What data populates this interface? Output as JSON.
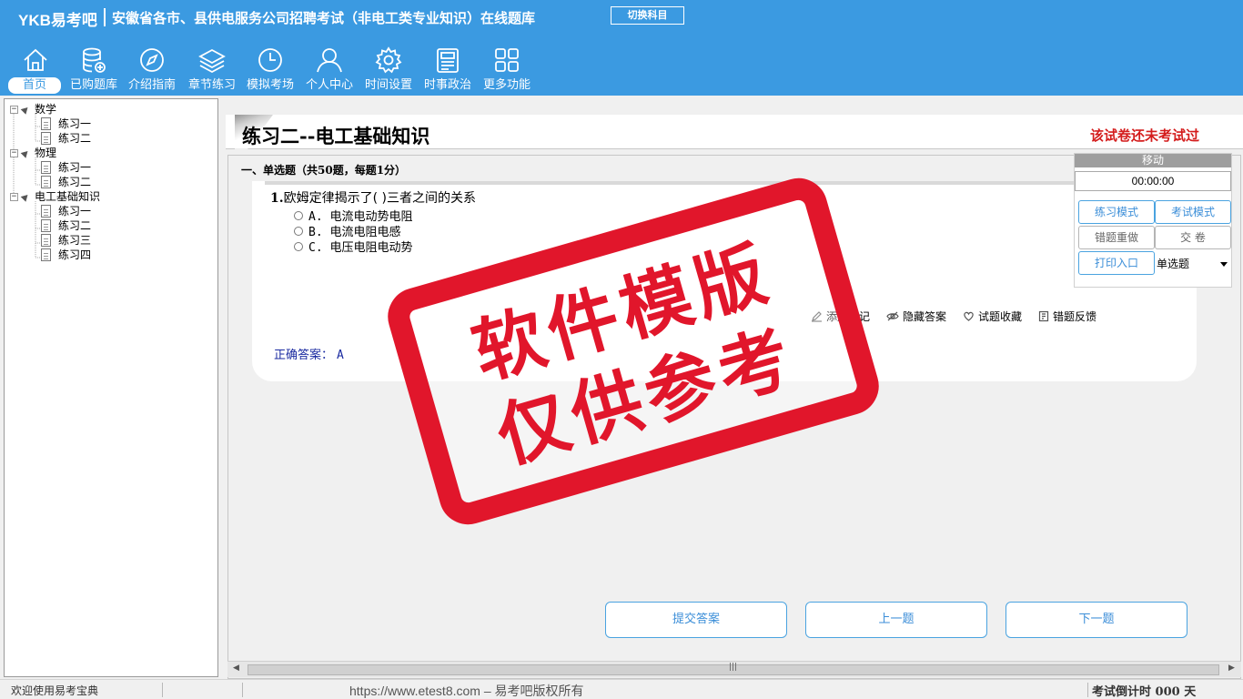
{
  "header": {
    "logo": "YKB易考吧",
    "title": "安徽省各市、县供电服务公司招聘考试（非电工类专业知识）在线题库",
    "switch_subject": "切换科目"
  },
  "nav": [
    {
      "label": "首页",
      "icon": "home-icon"
    },
    {
      "label": "已购题库",
      "icon": "database-add-icon"
    },
    {
      "label": "介绍指南",
      "icon": "compass-icon"
    },
    {
      "label": "章节练习",
      "icon": "layers-icon"
    },
    {
      "label": "模拟考场",
      "icon": "clock-icon"
    },
    {
      "label": "个人中心",
      "icon": "user-icon"
    },
    {
      "label": "时间设置",
      "icon": "gear-icon"
    },
    {
      "label": "时事政治",
      "icon": "newspaper-icon"
    },
    {
      "label": "更多功能",
      "icon": "grid-icon"
    }
  ],
  "tree": [
    {
      "label": "数学",
      "children": [
        {
          "label": "练习一"
        },
        {
          "label": "练习二"
        }
      ]
    },
    {
      "label": "物理",
      "children": [
        {
          "label": "练习一"
        },
        {
          "label": "练习二"
        }
      ]
    },
    {
      "label": "电工基础知识",
      "children": [
        {
          "label": "练习一"
        },
        {
          "label": "练习二"
        },
        {
          "label": "练习三"
        },
        {
          "label": "练习四"
        }
      ]
    }
  ],
  "paper": {
    "title": "练习二--电工基础知识",
    "status": "该试卷还未考试过",
    "section": "一、单选题（共50题，每题1分）"
  },
  "question": {
    "number": "1.",
    "text": "欧姆定律揭示了(  )三者之间的关系",
    "options": [
      "A. 电流电动势电阻",
      "B. 电流电阻电感",
      "C. 电压电阻电动势"
    ],
    "answer_label": "正确答案：",
    "answer_value": "A"
  },
  "actions": {
    "add_note": "添加笔记",
    "hide_answer": "隐藏答案",
    "favorite": "试题收藏",
    "report_error": "错题反馈"
  },
  "nav_buttons": {
    "submit": "提交答案",
    "prev": "上一题",
    "next": "下一题"
  },
  "panel": {
    "move": "移动",
    "timer": "00:00:00",
    "practice_mode": "练习模式",
    "exam_mode": "考试模式",
    "redo_wrong": "错题重做",
    "hand_in": "交  卷",
    "print": "打印入口",
    "type_select": "单选题"
  },
  "watermark": {
    "line1": "软件模版",
    "line2": "仅供参考"
  },
  "statusbar": {
    "welcome": "欢迎使用易考宝典",
    "copyright": "https://www.etest8.com – 易考吧版权所有",
    "countdown": "考试倒计时 000 天"
  }
}
